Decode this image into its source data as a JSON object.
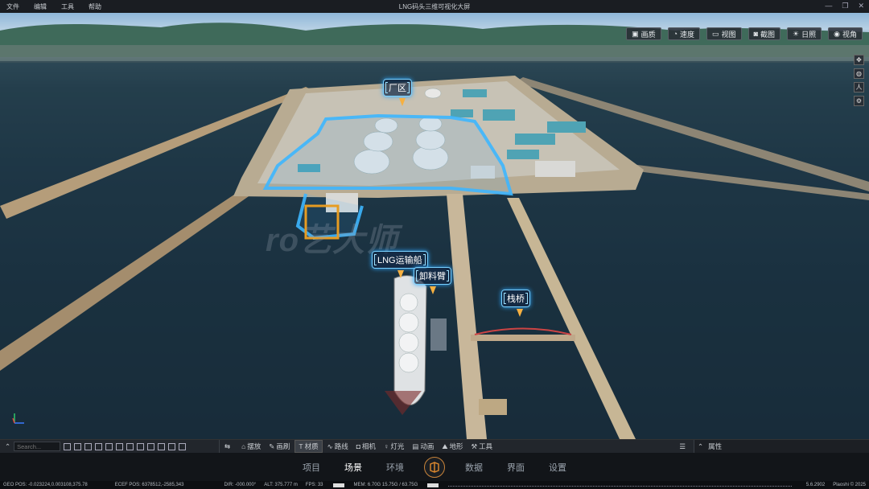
{
  "titlebar": {
    "menu": [
      "文件",
      "编辑",
      "工具",
      "帮助"
    ],
    "title": "LNG码头三维可视化大屏"
  },
  "top_buttons": [
    {
      "icon": "quality-icon",
      "label": "画质"
    },
    {
      "icon": "speed-icon",
      "label": "速度"
    },
    {
      "icon": "view-icon",
      "label": "视图"
    },
    {
      "icon": "screenshot-icon",
      "label": "截图"
    },
    {
      "icon": "sun-icon",
      "label": "日照"
    },
    {
      "icon": "eye-icon",
      "label": "视角"
    }
  ],
  "side_icons": [
    "compass-icon",
    "globe-icon",
    "person-icon",
    "settings-icon"
  ],
  "scene_labels": {
    "factory": "厂区",
    "ship": "LNG运输船",
    "arm": "卸料臂",
    "bridge": "栈桥"
  },
  "watermark": "ro艺大师",
  "toolbar": {
    "search_placeholder": "Search...",
    "tabs": [
      {
        "icon": "place-icon",
        "label": "摆放",
        "active": false
      },
      {
        "icon": "brush-icon",
        "label": "画刷",
        "active": false
      },
      {
        "icon": "material-icon",
        "label": "材质",
        "active": true
      },
      {
        "icon": "route-icon",
        "label": "路线",
        "active": false
      },
      {
        "icon": "camera-icon",
        "label": "相机",
        "active": false
      },
      {
        "icon": "light-icon",
        "label": "灯光",
        "active": false
      },
      {
        "icon": "animation-icon",
        "label": "动画",
        "active": false
      },
      {
        "icon": "terrain-icon",
        "label": "地形",
        "active": false
      },
      {
        "icon": "tool-icon",
        "label": "工具",
        "active": false
      }
    ],
    "properties_label": "属性"
  },
  "nav": {
    "items_left": [
      "项目",
      "场景",
      "环境"
    ],
    "items_right": [
      "数据",
      "界面",
      "设置"
    ],
    "active": "场景"
  },
  "status": {
    "geo_pos": "GEO POS: -0.023224,0.003108,375.78",
    "ecef_pos": "ECEF POS: 6378512,-2585,343",
    "dir": "DIR: -000.000°",
    "alt": "ALT: 375.777 m",
    "fps": "FPS: 33",
    "mem": "MEM: 6.70G  15.75G / 63.75G",
    "version": "5.6.2902",
    "copyright": "Plaoshi © 2025"
  },
  "colors": {
    "accent": "#2ea8ff",
    "pin": "#f6b041",
    "toolbar": "#22262c"
  }
}
